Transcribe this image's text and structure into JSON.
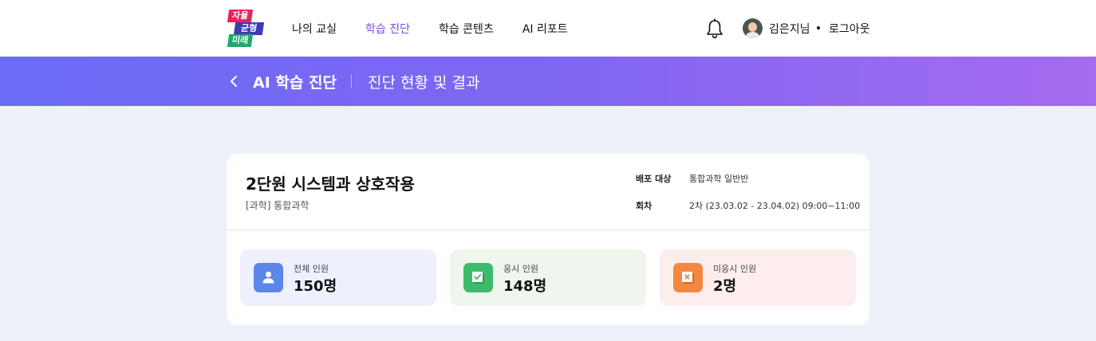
{
  "header": {
    "logo": {
      "line1": "자율",
      "line2": "균형",
      "line3": "미래"
    },
    "nav": [
      {
        "label": "나의 교실",
        "active": false
      },
      {
        "label": "학습 진단",
        "active": true
      },
      {
        "label": "학습 콘텐츠",
        "active": false
      },
      {
        "label": "AI 리포트",
        "active": false
      }
    ],
    "user_name": "김은지님",
    "logout_label": "로그아웃",
    "icons": {
      "notification": "bell-icon",
      "avatar": "user-avatar"
    }
  },
  "banner": {
    "title": "AI 학습 진단",
    "subtitle": "진단 현황 및 결과",
    "back_icon": "chevron-left-icon"
  },
  "card": {
    "title": "2단원 시스템과 상호작용",
    "subject": "[과학] 통합과학",
    "meta": {
      "target_label": "배포 대상",
      "target_value": "통합과학 일반반",
      "round_label": "회차",
      "round_value": "2차 (23.03.02 - 23.04.02) 09:00~11:00"
    },
    "stats": [
      {
        "label": "전체 인원",
        "value": "150명",
        "icon": "person-icon",
        "color": "#5c86ea"
      },
      {
        "label": "응시 인원",
        "value": "148명",
        "icon": "checked-paper-icon",
        "color": "#3dba6a"
      },
      {
        "label": "미응시 인원",
        "value": "2명",
        "icon": "x-paper-icon",
        "color": "#f4873f"
      }
    ]
  },
  "colors": {
    "accent": "#7b4de8",
    "banner_start": "#6a6cf5",
    "banner_end": "#a56bf0",
    "page_bg": "#eef1fa"
  }
}
